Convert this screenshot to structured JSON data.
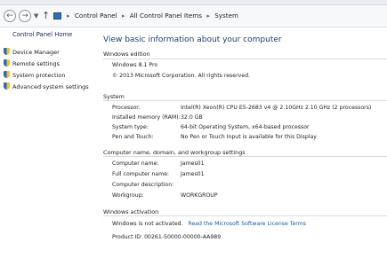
{
  "breadcrumbs": [
    "Control Panel",
    "All Control Panel Items",
    "System"
  ],
  "left_pane": {
    "home": "Control Panel Home",
    "links": [
      "Device Manager",
      "Remote settings",
      "System protection",
      "Advanced system settings"
    ]
  },
  "page_title": "View basic information about your computer",
  "windows_edition": {
    "heading": "Windows edition",
    "edition": "Windows 8.1 Pro",
    "copyright": "© 2013 Microsoft Corporation. All rights reserved."
  },
  "system": {
    "heading": "System",
    "rows": [
      {
        "label": "Processor:",
        "value": "Intel(R) Xeon(R) CPU E5-2683 v4 @ 2.10GHz   2.10 GHz  (2 processors)"
      },
      {
        "label": "Installed memory (RAM):",
        "value": "32.0 GB"
      },
      {
        "label": "System type:",
        "value": "64-bit Operating System, x64-based processor"
      },
      {
        "label": "Pen and Touch:",
        "value": "No Pen or Touch Input is available for this Display"
      }
    ]
  },
  "computer_name": {
    "heading": "Computer name, domain, and workgroup settings",
    "rows": [
      {
        "label": "Computer name:",
        "value": "James01"
      },
      {
        "label": "Full computer name:",
        "value": "James01"
      },
      {
        "label": "Computer description:",
        "value": ""
      },
      {
        "label": "Workgroup:",
        "value": "WORKGROUP"
      }
    ]
  },
  "activation": {
    "heading": "Windows activation",
    "status": "Windows is not activated.",
    "link": "Read the Microsoft Software License Terms",
    "product_id": "Product ID: 00261-50000-00000-AA989"
  },
  "colors": {
    "title": "#1a3f7a",
    "link": "#1a5aa3"
  }
}
